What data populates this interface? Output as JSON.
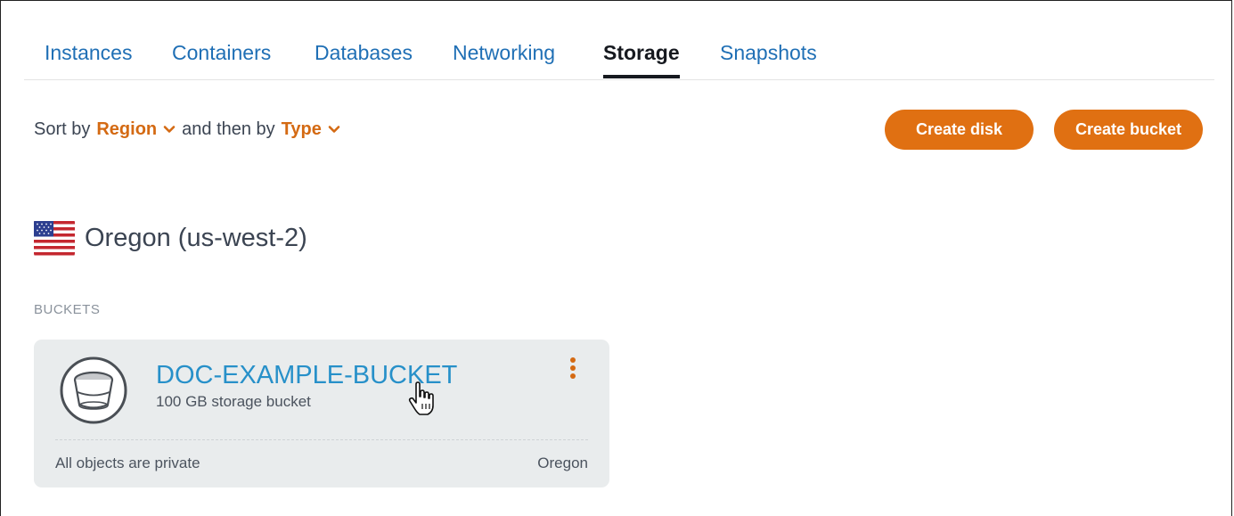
{
  "tabs": [
    {
      "label": "Instances",
      "active": false
    },
    {
      "label": "Containers",
      "active": false
    },
    {
      "label": "Databases",
      "active": false
    },
    {
      "label": "Networking",
      "active": false
    },
    {
      "label": "Storage",
      "active": true
    },
    {
      "label": "Snapshots",
      "active": false
    }
  ],
  "sort": {
    "prefix": "Sort by",
    "first": "Region",
    "middle": "and then by",
    "second": "Type"
  },
  "actions": {
    "create_disk": "Create disk",
    "create_bucket": "Create bucket"
  },
  "region": {
    "name": "Oregon (us-west-2)",
    "flag_icon": "us-flag-icon"
  },
  "buckets_section": {
    "label": "BUCKETS"
  },
  "bucket": {
    "name": "DOC-EXAMPLE-BUCKET",
    "description": "100 GB storage bucket",
    "access": "All objects are private",
    "location": "Oregon",
    "icon": "bucket-icon",
    "menu_icon": "kebab-menu-icon"
  },
  "colors": {
    "accent": "#e07012",
    "link": "#1f6fb5",
    "bucket_link": "#2790c9",
    "card_bg": "#e9eced"
  }
}
